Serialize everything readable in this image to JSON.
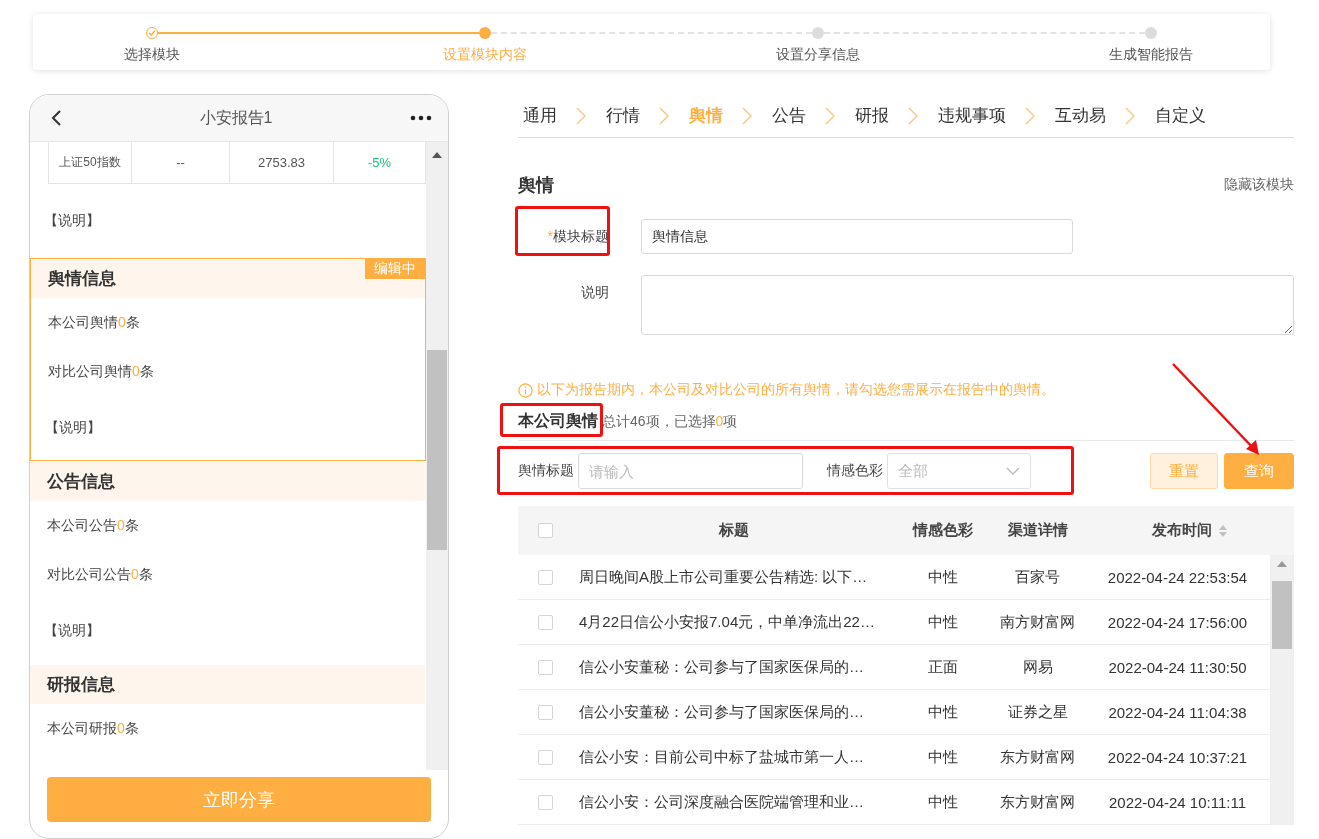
{
  "steps": [
    {
      "label": "选择模块",
      "done": true,
      "current": false
    },
    {
      "label": "设置模块内容",
      "done": false,
      "current": true
    },
    {
      "label": "设置分享信息",
      "done": false,
      "current": false
    },
    {
      "label": "生成智能报告",
      "done": false,
      "current": false
    }
  ],
  "phone": {
    "title": "小安报告1",
    "index_row": [
      "上证50指数",
      "--",
      "2753.83",
      "-5%"
    ],
    "intro_note": "【说明】",
    "sections": [
      {
        "title": "舆情信息",
        "editing": true,
        "badge": "编辑中",
        "lines": [
          {
            "prefix": "本公司舆情",
            "count": "0",
            "suffix": "条"
          },
          {
            "prefix": "对比公司舆情",
            "count": "0",
            "suffix": "条"
          }
        ],
        "note": "【说明】"
      },
      {
        "title": "公告信息",
        "editing": false,
        "lines": [
          {
            "prefix": "本公司公告",
            "count": "0",
            "suffix": "条"
          },
          {
            "prefix": "对比公司公告",
            "count": "0",
            "suffix": "条"
          }
        ],
        "note": "【说明】"
      },
      {
        "title": "研报信息",
        "editing": false,
        "lines": [
          {
            "prefix": "本公司研报",
            "count": "0",
            "suffix": "条"
          }
        ]
      }
    ],
    "share_button": "立即分享"
  },
  "tabs": [
    {
      "label": "通用",
      "selected": false
    },
    {
      "label": "行情",
      "selected": false
    },
    {
      "label": "舆情",
      "selected": true
    },
    {
      "label": "公告",
      "selected": false
    },
    {
      "label": "研报",
      "selected": false
    },
    {
      "label": "违规事项",
      "selected": false
    },
    {
      "label": "互动易",
      "selected": false
    },
    {
      "label": "自定义",
      "selected": false
    }
  ],
  "module": {
    "title": "舆情",
    "hide_link": "隐藏该模块",
    "title_field": {
      "label": "模块标题",
      "required_mark": "*",
      "value": "舆情信息"
    },
    "desc_field": {
      "label": "说明"
    },
    "notice": "以下为报告期内，本公司及对比公司的所有舆情，请勾选您需展示在报告中的舆情。"
  },
  "list": {
    "title": "本公司舆情",
    "summary_prefix": "总计46项，已选择",
    "selected_count": "0",
    "summary_suffix": "项",
    "filters": [
      {
        "kind": "input",
        "label": "舆情标题",
        "placeholder": "请输入"
      },
      {
        "kind": "select",
        "label": "情感色彩",
        "placeholder": "全部"
      }
    ],
    "all_checked": false,
    "reset_button": "重置",
    "query_button": "查询",
    "columns": [
      {
        "label": "标题",
        "sortable": false
      },
      {
        "label": "情感色彩",
        "sortable": false
      },
      {
        "label": "渠道详情",
        "sortable": false
      },
      {
        "label": "发布时间",
        "sortable": true
      }
    ],
    "rows": [
      {
        "checked": false,
        "title": "周日晚间A股上市公司重要公告精选: 以下…",
        "sentiment": "中性",
        "channel": "百家号",
        "time": "2022-04-24 22:53:54"
      },
      {
        "checked": false,
        "title": "4月22日信公小安报7.04元，中单净流出22…",
        "sentiment": "中性",
        "channel": "南方财富网",
        "time": "2022-04-24 17:56:00"
      },
      {
        "checked": false,
        "title": "信公小安董秘：公司参与了国家医保局的…",
        "sentiment": "正面",
        "channel": "网易",
        "time": "2022-04-24 11:30:50"
      },
      {
        "checked": false,
        "title": "信公小安董秘：公司参与了国家医保局的…",
        "sentiment": "中性",
        "channel": "证券之星",
        "time": "2022-04-24 11:04:38"
      },
      {
        "checked": false,
        "title": "信公小安：目前公司中标了盐城市第一人…",
        "sentiment": "中性",
        "channel": "东方财富网",
        "time": "2022-04-24 10:37:21"
      },
      {
        "checked": false,
        "title": "信公小安：公司深度融合医院端管理和业…",
        "sentiment": "中性",
        "channel": "东方财富网",
        "time": "2022-04-24 10:11:11"
      }
    ]
  }
}
